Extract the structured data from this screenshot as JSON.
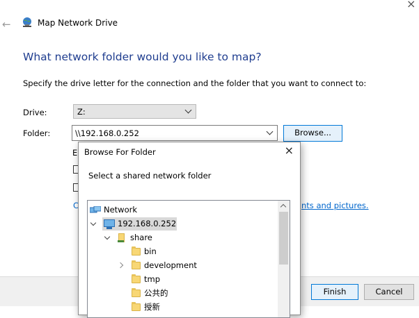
{
  "wizard": {
    "title": "Map Network Drive",
    "heading": "What network folder would you like to map?",
    "instruction": "Specify the drive letter for the connection and the folder that you want to connect to:",
    "drive_label": "Drive:",
    "drive_value": "Z:",
    "folder_label": "Folder:",
    "folder_value": "\\\\192.168.0.252",
    "browse_label": "Browse...",
    "partial_label_e": "E",
    "partial_link_c": "C",
    "partial_link_tail": "nts and pictures.",
    "finish_label": "Finish",
    "cancel_label": "Cancel"
  },
  "browse_dialog": {
    "title": "Browse For Folder",
    "description": "Select a shared network folder",
    "tree": {
      "network": "Network",
      "host": "192.168.0.252",
      "share": "share",
      "bin": "bin",
      "development": "development",
      "tmp": "tmp",
      "public": "公共的",
      "partial_item": "授新"
    }
  },
  "colors": {
    "heading": "#1f3d8f",
    "link": "#0066cc",
    "accent_border": "#0078d7",
    "selection": "#d9d9d9"
  },
  "icons": {
    "back": "back-arrow-icon",
    "wizard": "map-network-drive-icon",
    "close": "close-icon",
    "network": "network-icon",
    "computer": "computer-icon",
    "share": "network-share-icon",
    "folder": "folder-icon"
  }
}
